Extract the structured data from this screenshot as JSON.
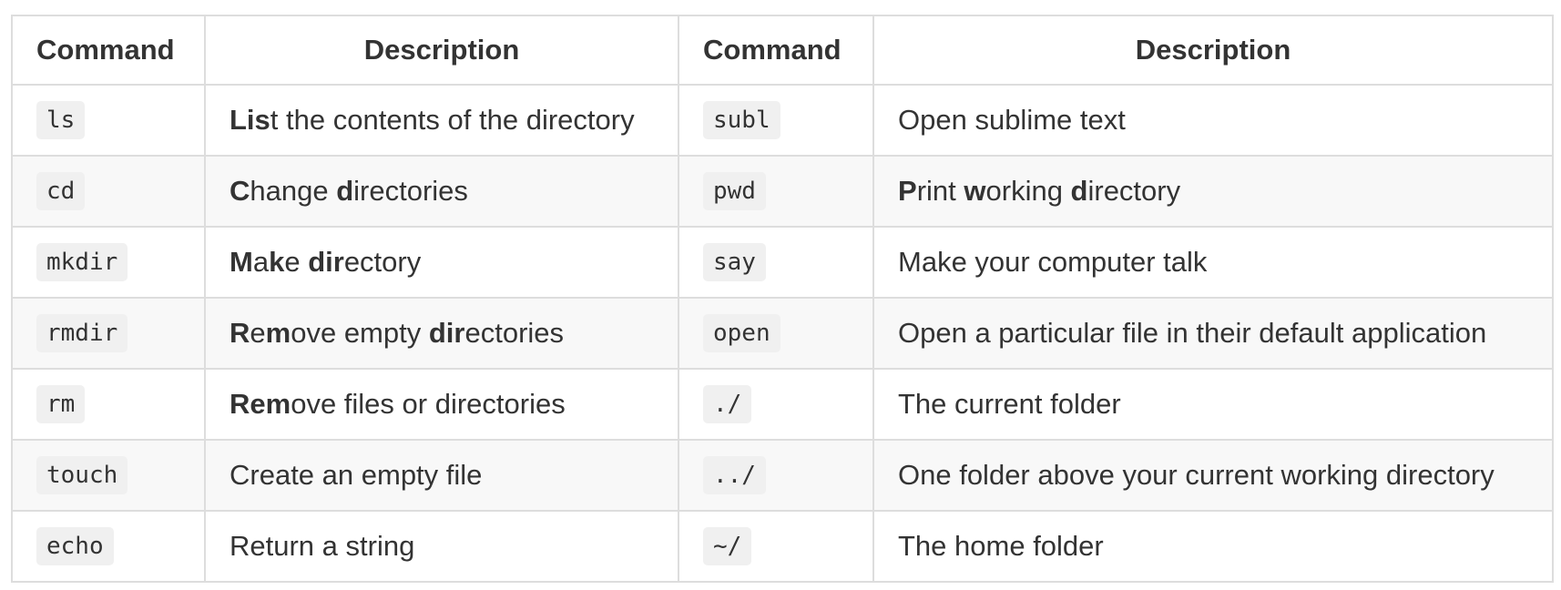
{
  "headers": [
    "Command",
    "Description",
    "Command",
    "Description"
  ],
  "rows": [
    {
      "cmd1": "ls",
      "desc1": [
        {
          "t": "Lis",
          "b": true
        },
        {
          "t": "t the contents of the directory",
          "b": false
        }
      ],
      "cmd2": "subl",
      "desc2": [
        {
          "t": "Open sublime text",
          "b": false
        }
      ]
    },
    {
      "cmd1": "cd",
      "desc1": [
        {
          "t": "C",
          "b": true
        },
        {
          "t": "hange ",
          "b": false
        },
        {
          "t": "d",
          "b": true
        },
        {
          "t": "irectories",
          "b": false
        }
      ],
      "cmd2": "pwd",
      "desc2": [
        {
          "t": "P",
          "b": true
        },
        {
          "t": "rint ",
          "b": false
        },
        {
          "t": "w",
          "b": true
        },
        {
          "t": "orking ",
          "b": false
        },
        {
          "t": "d",
          "b": true
        },
        {
          "t": "irectory",
          "b": false
        }
      ]
    },
    {
      "cmd1": "mkdir",
      "desc1": [
        {
          "t": "M",
          "b": true
        },
        {
          "t": "a",
          "b": false
        },
        {
          "t": "k",
          "b": true
        },
        {
          "t": "e ",
          "b": false
        },
        {
          "t": "dir",
          "b": true
        },
        {
          "t": "ectory",
          "b": false
        }
      ],
      "cmd2": "say",
      "desc2": [
        {
          "t": "Make your computer talk",
          "b": false
        }
      ]
    },
    {
      "cmd1": "rmdir",
      "desc1": [
        {
          "t": "R",
          "b": true
        },
        {
          "t": "e",
          "b": false
        },
        {
          "t": "m",
          "b": true
        },
        {
          "t": "ove empty ",
          "b": false
        },
        {
          "t": "dir",
          "b": true
        },
        {
          "t": "ectories",
          "b": false
        }
      ],
      "cmd2": "open",
      "desc2": [
        {
          "t": "Open a particular file in their default application",
          "b": false
        }
      ]
    },
    {
      "cmd1": "rm",
      "desc1": [
        {
          "t": "Rem",
          "b": true
        },
        {
          "t": "ove files or directories",
          "b": false
        }
      ],
      "cmd2": "./",
      "desc2": [
        {
          "t": "The current folder",
          "b": false
        }
      ]
    },
    {
      "cmd1": "touch",
      "desc1": [
        {
          "t": "Create an empty file",
          "b": false
        }
      ],
      "cmd2": "../",
      "desc2": [
        {
          "t": "One folder above your current working directory",
          "b": false
        }
      ]
    },
    {
      "cmd1": "echo",
      "desc1": [
        {
          "t": "Return a string",
          "b": false
        }
      ],
      "cmd2": "~/",
      "desc2": [
        {
          "t": "The home folder",
          "b": false
        }
      ]
    }
  ]
}
